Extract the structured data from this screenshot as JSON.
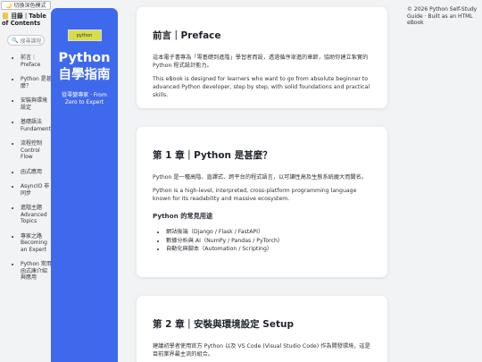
{
  "theme_toggle": {
    "icon": "moon-icon",
    "label": "切換深色模式"
  },
  "toc": {
    "icon": "book-icon",
    "title": "目錄｜Table of Contents",
    "search_placeholder": "搜尋課程",
    "items": [
      {
        "label": "前言｜Preface"
      },
      {
        "label": "Python 是甚麼？"
      },
      {
        "label": "安裝與環境設定"
      },
      {
        "label": "基礎語法 Fundamentals"
      },
      {
        "label": "流程控制 Control Flow"
      },
      {
        "label": "函式應用"
      },
      {
        "label": "AsyncIO 非同步"
      },
      {
        "label": "進階主題 Advanced Topics"
      },
      {
        "label": "專家之路 Becoming an Expert"
      },
      {
        "label": "Python 常用函式庫介紹與應用"
      }
    ]
  },
  "hero": {
    "logo_text": "python",
    "title": "Python 自學指南",
    "subtitle": "從零變專家 · From Zero to Expert"
  },
  "sections": [
    {
      "title": "前言｜Preface",
      "paragraphs": [
        "這本電子書專為「零基礎到進階」學習者而設，透過循序漸進的章節，協助你建立紮實的 Python 程式設計能力。",
        "This eBook is designed for learners who want to go from absolute beginner to advanced Python developer, step by step, with solid foundations and practical skills."
      ]
    },
    {
      "title": "第 1 章｜Python 是甚麼？",
      "paragraphs": [
        "Python 是一種高階、直譯式、跨平台的程式語言，以可讀性高及生態系統龐大而聞名。",
        "Python is a high-level, interpreted, cross-platform programming language known for its readability and massive ecosystem."
      ],
      "subheading": "Python 的常見用途",
      "bullets": [
        "網站後端（Django / Flask / FastAPI）",
        "數據分析與 AI（NumPy / Pandas / PyTorch）",
        "自動化與腳本（Automation / Scripting）"
      ]
    },
    {
      "title": "第 2 章｜安裝與環境設定 Setup",
      "paragraphs": [
        "建議初學者使用官方 Python 以及 VS Code (Visual Studio Code) 作為開發環境，這是目前業界最主流的組合。"
      ]
    }
  ],
  "footer_note": "© 2026 Python Self-Study Guide · Built as an HTML eBook"
}
